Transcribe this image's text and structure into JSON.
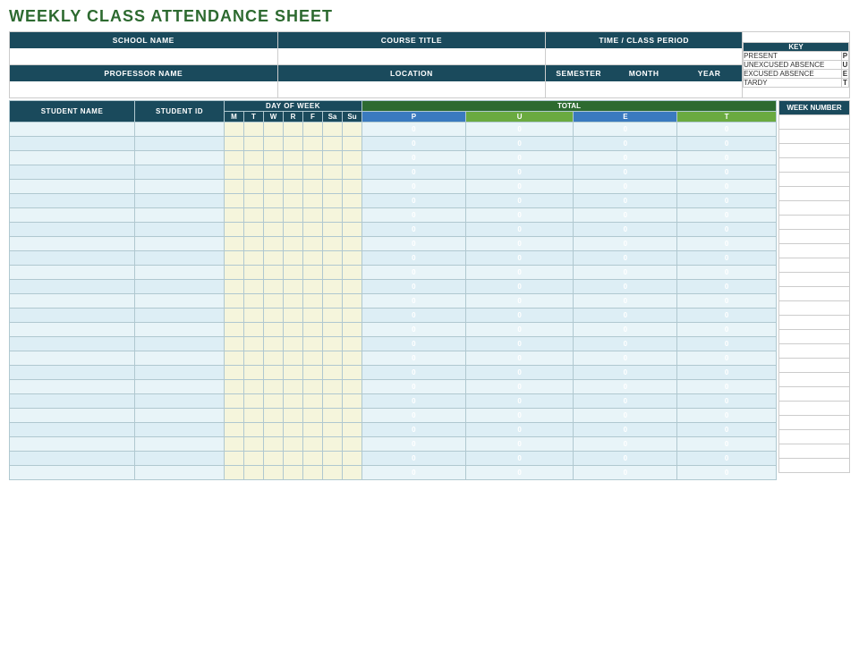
{
  "title": "WEEKLY CLASS ATTENDANCE SHEET",
  "header": {
    "school_name_label": "SCHOOL NAME",
    "course_title_label": "COURSE TITLE",
    "time_class_period_label": "TIME / CLASS PERIOD",
    "professor_name_label": "PROFESSOR NAME",
    "location_label": "LOCATION",
    "semester_label": "SEMESTER",
    "month_label": "MONTH",
    "year_label": "YEAR"
  },
  "key": {
    "title": "KEY",
    "rows": [
      {
        "label": "PRESENT",
        "value": "P"
      },
      {
        "label": "UNEXCUSED ABSENCE",
        "value": "U"
      },
      {
        "label": "EXCUSED ABSENCE",
        "value": "E"
      },
      {
        "label": "TARDY",
        "value": "T"
      }
    ]
  },
  "table": {
    "col_student_name": "STUDENT NAME",
    "col_student_id": "STUDENT ID",
    "col_day_of_week": "DAY OF WEEK",
    "col_days": [
      "M",
      "T",
      "W",
      "R",
      "F",
      "Sa",
      "Su"
    ],
    "col_total": "TOTAL",
    "col_total_sub": [
      "P",
      "U",
      "E",
      "T"
    ],
    "col_week_number": "WEEK NUMBER",
    "zero": "0",
    "num_rows": 25
  }
}
